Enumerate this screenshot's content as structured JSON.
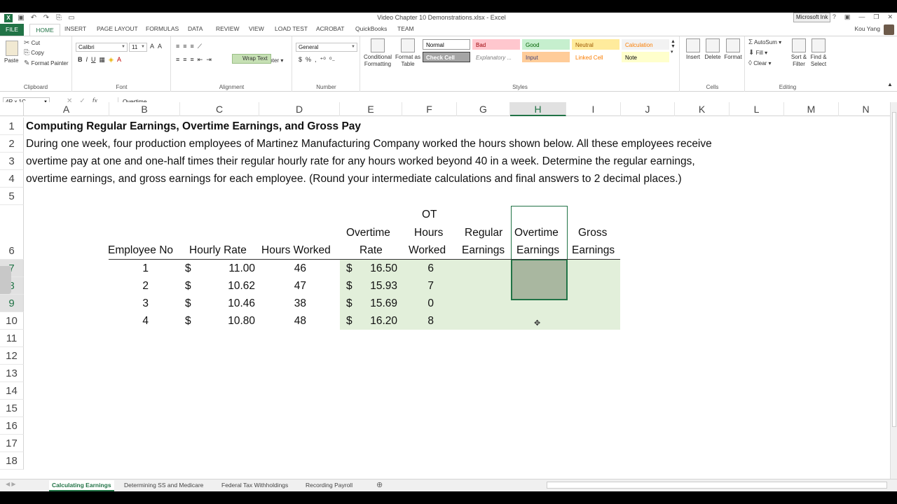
{
  "title_bar": {
    "qat": [
      "excel-logo-icon",
      "save-icon",
      "undo-icon",
      "redo-icon",
      "format-icon",
      "new-icon"
    ],
    "title": "Video Chapter 10 Demonstrations.xlsx - Excel",
    "ink_button": "Microsoft Ink",
    "window_controls": [
      "?",
      "restore-ribbon-icon",
      "minimize-icon",
      "maximize-icon",
      "close-icon"
    ]
  },
  "ribbon_tabs": {
    "file": "FILE",
    "items": [
      "HOME",
      "INSERT",
      "PAGE LAYOUT",
      "FORMULAS",
      "DATA",
      "REVIEW",
      "VIEW",
      "LOAD TEST",
      "ACROBAT",
      "QuickBooks",
      "TEAM"
    ],
    "user": "Kou Yang"
  },
  "ribbon": {
    "clipboard": {
      "label": "Clipboard",
      "paste": "Paste",
      "cut": "Cut",
      "copy": "Copy",
      "format_painter": "Format Painter"
    },
    "font": {
      "label": "Font",
      "font_name": "Calibri",
      "font_size": "11",
      "bold": "B",
      "italic": "I",
      "underline": "U"
    },
    "alignment": {
      "label": "Alignment",
      "wrap_text": "Wrap Text",
      "merge_center": "Merge & Center"
    },
    "number": {
      "label": "Number",
      "format": "General",
      "currency": "$",
      "percent": "%",
      "comma": ","
    },
    "styles": {
      "label": "Styles",
      "conditional": "Conditional Formatting",
      "format_table": "Format as Table",
      "cells": [
        {
          "name": "Normal",
          "bg": "#ffffff",
          "fg": "#000000"
        },
        {
          "name": "Bad",
          "bg": "#ffc7ce",
          "fg": "#9c0006"
        },
        {
          "name": "Good",
          "bg": "#c6efce",
          "fg": "#006100"
        },
        {
          "name": "Neutral",
          "bg": "#ffeb9c",
          "fg": "#9c5700"
        },
        {
          "name": "Calculation",
          "bg": "#f2f2f2",
          "fg": "#fa7d00"
        },
        {
          "name": "Check Cell",
          "bg": "#a5a5a5",
          "fg": "#ffffff"
        },
        {
          "name": "Explanatory ...",
          "bg": "#ffffff",
          "fg": "#7f7f7f"
        },
        {
          "name": "Input",
          "bg": "#ffcc99",
          "fg": "#3f3f76"
        },
        {
          "name": "Linked Cell",
          "bg": "#ffffff",
          "fg": "#fa7d00"
        },
        {
          "name": "Note",
          "bg": "#ffffcc",
          "fg": "#000000"
        }
      ]
    },
    "cells": {
      "label": "Cells",
      "insert": "Insert",
      "delete": "Delete",
      "format": "Format"
    },
    "editing": {
      "label": "Editing",
      "autosum": "AutoSum",
      "fill": "Fill",
      "clear": "Clear",
      "sort_filter": "Sort & Filter",
      "find_select": "Find & Select"
    }
  },
  "formula_bar": {
    "name_box": "4R x 1C",
    "value": "Overtime"
  },
  "columns": [
    "A",
    "B",
    "C",
    "D",
    "E",
    "F",
    "G",
    "H",
    "I",
    "J",
    "K",
    "L",
    "M",
    "N"
  ],
  "selected_column": "H",
  "rows": [
    "1",
    "2",
    "3",
    "4",
    "5",
    "6",
    "7",
    "8",
    "9",
    "10",
    "11",
    "12",
    "13",
    "14",
    "15",
    "16",
    "17",
    "18"
  ],
  "sheet": {
    "heading": "Computing Regular Earnings, Overtime Earnings, and Gross Pay",
    "paragraph_lines": [
      "During one week, four production employees of Martinez Manufacturing Company worked the hours shown below. All these employees receive",
      "overtime pay at one and one-half times their regular hourly rate for any hours worked beyond 40 in a week. Determine the regular earnings,",
      "overtime earnings, and gross earnings for each employee. (Round your intermediate calculations and final answers to 2 decimal places.)"
    ],
    "headers": {
      "employee_no": "Employee No",
      "hourly_rate": "Hourly Rate",
      "hours_worked": "Hours Worked",
      "overtime_rate": [
        "Overtime",
        "Rate"
      ],
      "ot_hours": [
        "OT",
        "Hours",
        "Worked"
      ],
      "regular_earnings": [
        "Regular",
        "Earnings"
      ],
      "overtime_earnings": [
        "Overtime",
        "Earnings"
      ],
      "gross_earnings": [
        "Gross",
        "Earnings"
      ]
    },
    "currency": "$",
    "employees": [
      {
        "no": "1",
        "rate": "11.00",
        "hours": "46",
        "ot_rate": "16.50",
        "ot_hours": "6"
      },
      {
        "no": "2",
        "rate": "10.62",
        "hours": "47",
        "ot_rate": "15.93",
        "ot_hours": "7"
      },
      {
        "no": "3",
        "rate": "10.46",
        "hours": "38",
        "ot_rate": "15.69",
        "ot_hours": "0"
      },
      {
        "no": "4",
        "rate": "10.80",
        "hours": "48",
        "ot_rate": "16.20",
        "ot_hours": "8"
      }
    ]
  },
  "sheet_tabs": [
    "Calculating Earnings",
    "Determining SS and Medicare",
    "Federal Tax Withholdings",
    "Recording Payroll"
  ],
  "active_sheet": "Calculating Earnings",
  "colors": {
    "accent": "#217346",
    "input_fill": "#e2efda",
    "selection_fill": "#a9b7a0"
  }
}
